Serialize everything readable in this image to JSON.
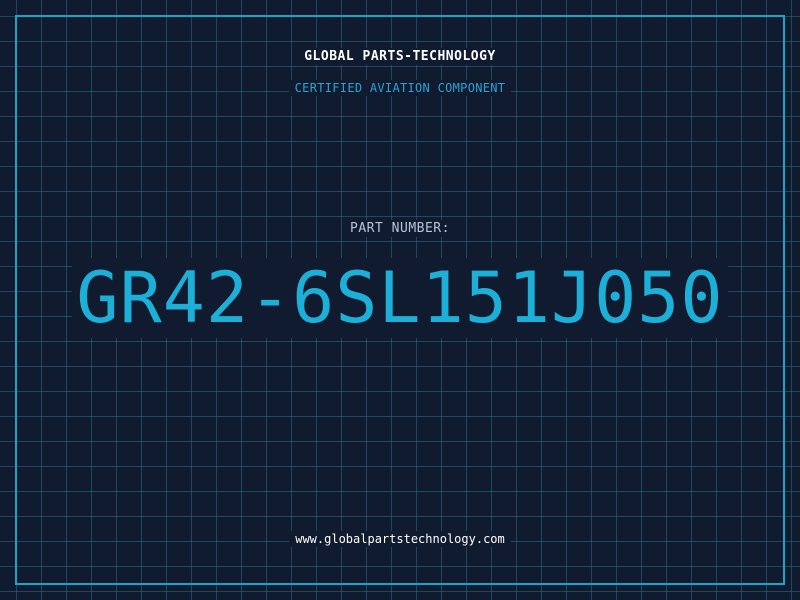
{
  "header": {
    "company": "GLOBAL PARTS-TECHNOLOGY",
    "tagline": "CERTIFIED AVIATION COMPONENT"
  },
  "part": {
    "label": "PART NUMBER:",
    "number": "GR42-6SL151J050"
  },
  "footer": {
    "website": "www.globalpartstechnology.com"
  },
  "colors": {
    "background": "#111b30",
    "grid": "#286e82",
    "frame": "#1ba4c9",
    "accent": "#1cb0d9",
    "tagline": "#29a3d6",
    "label": "#b7c4d4",
    "text": "#ffffff"
  }
}
